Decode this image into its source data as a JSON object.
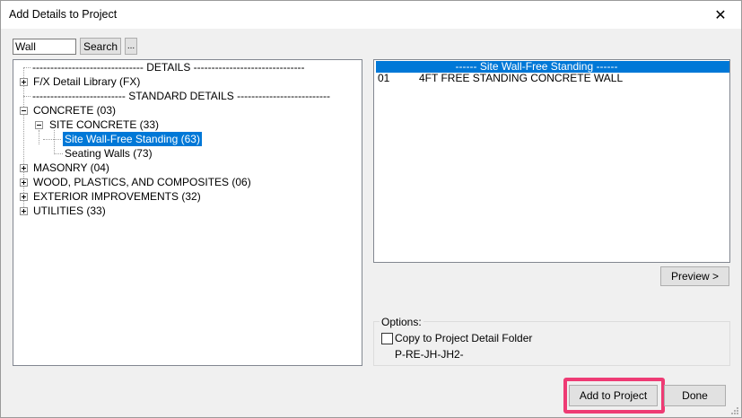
{
  "window": {
    "title": "Add Details to Project",
    "close_glyph": "✕"
  },
  "search": {
    "value": "Wall",
    "button_label": "Search",
    "more_label": "..."
  },
  "tree": {
    "details_header": "------------------------------- DETAILS -------------------------------",
    "fx_library": "F/X Detail Library (FX)",
    "standard_header": "-------------------------- STANDARD DETAILS --------------------------",
    "concrete": "CONCRETE (03)",
    "site_concrete": "SITE CONCRETE (33)",
    "site_wall": "Site Wall-Free Standing (63)",
    "seating_walls": "Seating Walls (73)",
    "masonry": "MASONRY (04)",
    "wood": "WOOD, PLASTICS, AND COMPOSITES (06)",
    "exterior": "EXTERIOR IMPROVEMENTS (32)",
    "utilities": "UTILITIES (33)"
  },
  "detail_list": {
    "header": "------ Site Wall-Free Standing ------",
    "rows": [
      {
        "number": "01",
        "name": "4FT FREE STANDING CONCRETE WALL"
      }
    ]
  },
  "preview": {
    "label": "Preview >"
  },
  "options": {
    "group_label": "Options:",
    "copy_label": "Copy to Project Detail Folder",
    "copy_checked": false,
    "folder": "P-RE-JH-JH2-"
  },
  "actions": {
    "add_label": "Add to Project",
    "done_label": "Done"
  },
  "colors": {
    "selection": "#0078d7",
    "highlight": "#ee3b74"
  }
}
